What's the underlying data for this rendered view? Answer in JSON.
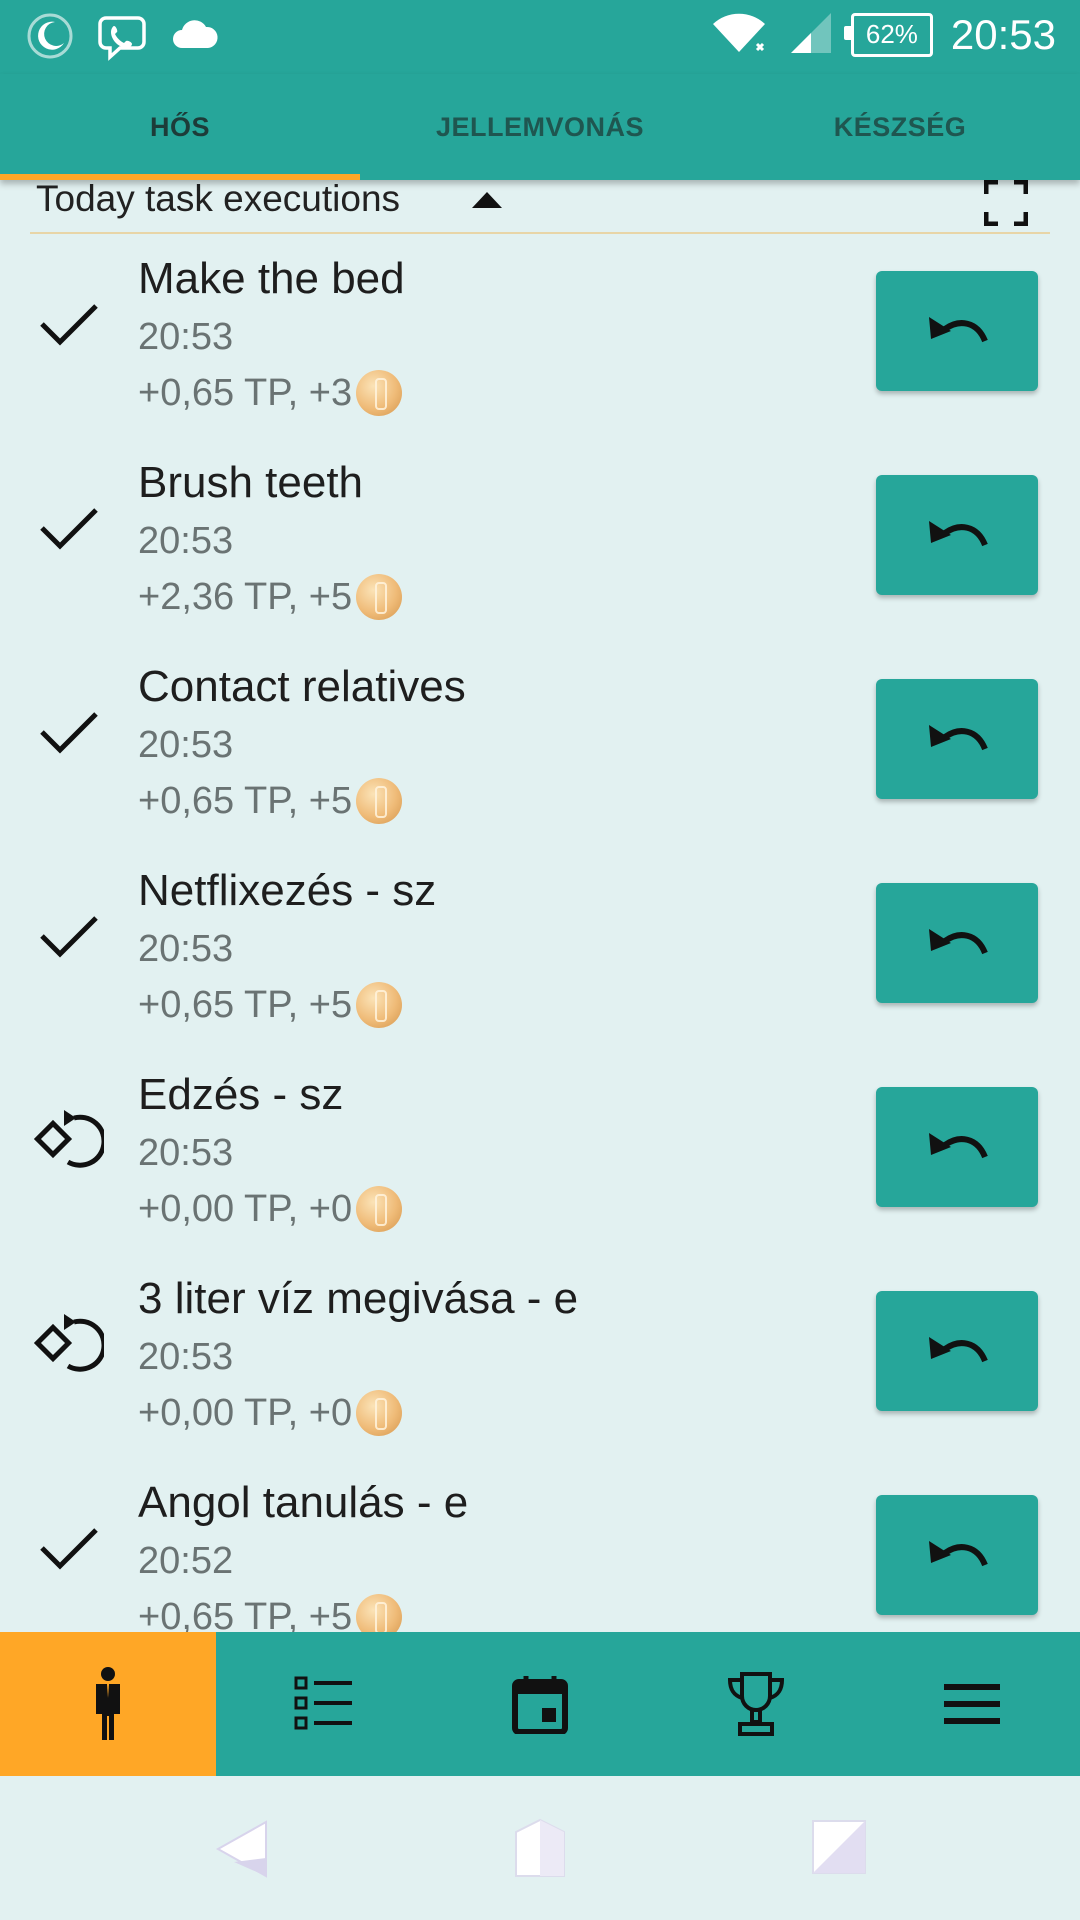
{
  "status_bar": {
    "time": "20:53",
    "battery": "62%",
    "left_icons": [
      "moon-icon",
      "viber-icon",
      "cloud-icon"
    ],
    "right_icons": [
      "wifi-icon",
      "signal-icon",
      "battery-icon"
    ]
  },
  "tabs": [
    {
      "label": "HŐS",
      "active": true
    },
    {
      "label": "JELLEMVONÁS",
      "active": false
    },
    {
      "label": "KÉSZSÉG",
      "active": false
    }
  ],
  "section": {
    "title": "Today task executions"
  },
  "tasks": [
    {
      "title": "Make the bed",
      "time": "20:53",
      "reward": "+0,65 TP, +3",
      "status_icon": "check-icon"
    },
    {
      "title": "Brush teeth",
      "time": "20:53",
      "reward": "+2,36 TP, +5",
      "status_icon": "check-icon"
    },
    {
      "title": "Contact relatives",
      "time": "20:53",
      "reward": "+0,65 TP, +5",
      "status_icon": "check-icon"
    },
    {
      "title": "Netflixezés - sz",
      "time": "20:53",
      "reward": "+0,65 TP, +5",
      "status_icon": "check-icon"
    },
    {
      "title": "Edzés - sz",
      "time": "20:53",
      "reward": "+0,00 TP, +0",
      "status_icon": "rotate-icon"
    },
    {
      "title": "3 liter víz megivása - e",
      "time": "20:53",
      "reward": "+0,00 TP, +0",
      "status_icon": "rotate-icon"
    },
    {
      "title": "Angol tanulás - e",
      "time": "20:52",
      "reward": "+0,65 TP, +5",
      "status_icon": "check-icon"
    }
  ],
  "bottom_nav": [
    {
      "icon": "hero-person-icon",
      "active": true
    },
    {
      "icon": "checklist-icon",
      "active": false
    },
    {
      "icon": "calendar-icon",
      "active": false
    },
    {
      "icon": "trophy-icon",
      "active": false
    },
    {
      "icon": "menu-icon",
      "active": false
    }
  ],
  "colors": {
    "primary": "#26a69a",
    "accent": "#ffa726",
    "background": "#e2f1f1"
  }
}
